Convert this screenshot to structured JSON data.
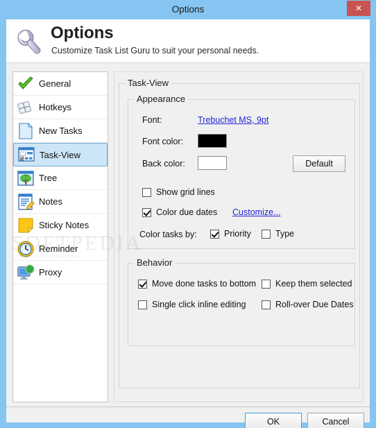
{
  "window": {
    "title": "Options",
    "close_label": "✕"
  },
  "header": {
    "icon": "wrench-icon",
    "title": "Options",
    "subtitle": "Customize Task List Guru to suit your personal needs."
  },
  "sidebar": {
    "items": [
      {
        "label": "General",
        "icon": "green-check-icon",
        "selected": false
      },
      {
        "label": "Hotkeys",
        "icon": "keyboard-keys-icon",
        "selected": false
      },
      {
        "label": "New Tasks",
        "icon": "blank-page-icon",
        "selected": false
      },
      {
        "label": "Task-View",
        "icon": "list-view-icon",
        "selected": true
      },
      {
        "label": "Tree",
        "icon": "tree-icon",
        "selected": false
      },
      {
        "label": "Notes",
        "icon": "notepad-pencil-icon",
        "selected": false
      },
      {
        "label": "Sticky Notes",
        "icon": "sticky-note-icon",
        "selected": false
      },
      {
        "label": "Reminder",
        "icon": "clock-icon",
        "selected": false
      },
      {
        "label": "Proxy",
        "icon": "monitor-globe-icon",
        "selected": false
      }
    ]
  },
  "main": {
    "group_title": "Task-View",
    "appearance": {
      "legend": "Appearance",
      "font_label": "Font:",
      "font_value": "Trebuchet MS, 9pt",
      "font_color_label": "Font color:",
      "font_color_value": "#000000",
      "back_color_label": "Back color:",
      "back_color_value": "#ffffff",
      "default_button": "Default",
      "show_grid_lines": {
        "label": "Show grid lines",
        "checked": false
      },
      "color_due_dates": {
        "label": "Color due dates",
        "checked": true
      },
      "customize_link": "Customize...",
      "color_tasks_by_label": "Color tasks by:",
      "color_by_priority": {
        "label": "Priority",
        "checked": true
      },
      "color_by_type": {
        "label": "Type",
        "checked": false
      }
    },
    "behavior": {
      "legend": "Behavior",
      "move_done_tasks": {
        "label": "Move done tasks to bottom",
        "checked": true
      },
      "keep_them_selected": {
        "label": "Keep them selected",
        "checked": false
      },
      "single_click_inline": {
        "label": "Single click inline editing",
        "checked": false
      },
      "rollover_due_dates": {
        "label": "Roll-over Due Dates",
        "checked": false
      }
    }
  },
  "footer": {
    "ok_label": "OK",
    "cancel_label": "Cancel"
  },
  "watermark": {
    "text": "SOFTPEDIA",
    "subtext": "www.softpedia.com"
  },
  "colors": {
    "titlebar": "#86c5f2",
    "close_button": "#c75450",
    "selection": "#cde6f7",
    "link": "#2424d8",
    "body": "#f0f0f0"
  }
}
